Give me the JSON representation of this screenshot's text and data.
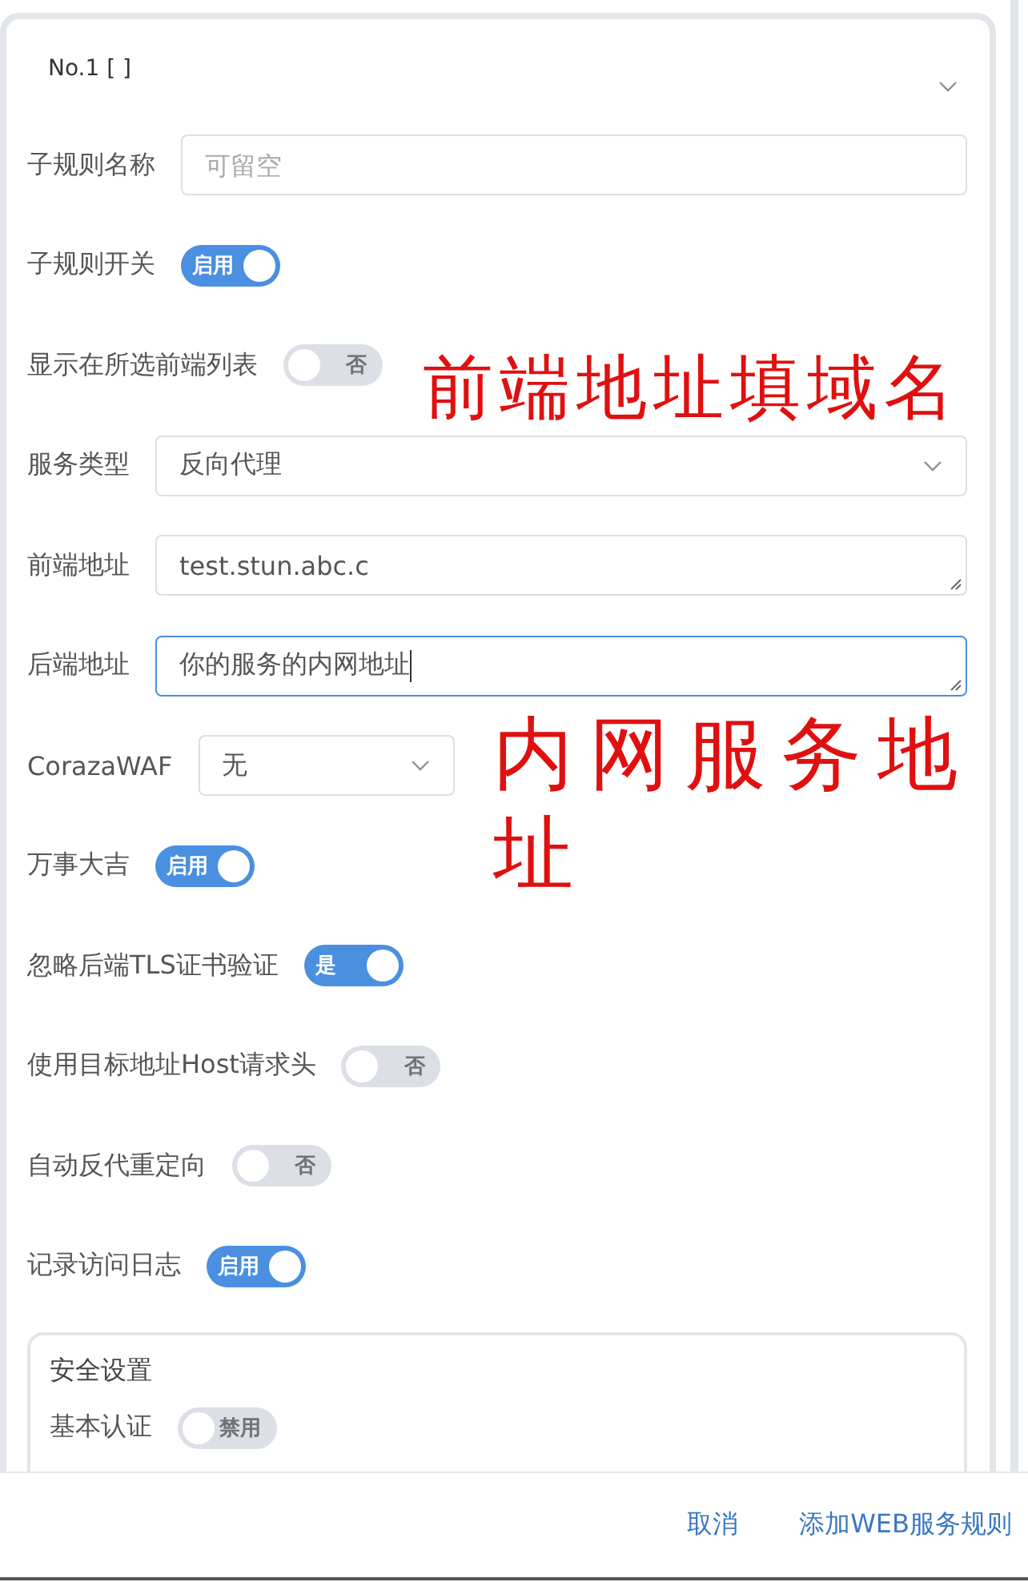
{
  "rule": {
    "title": "No.1 [ ]",
    "expanded": true
  },
  "fields": [
    {
      "kind": "input",
      "label": "子规则名称",
      "placeholder": "可留空"
    },
    {
      "kind": "switch",
      "label": "子规则开关",
      "on": true,
      "text": "启用"
    },
    {
      "kind": "switch",
      "label": "显示在所选前端列表",
      "on": false,
      "text": "否"
    },
    {
      "kind": "select",
      "label": "服务类型",
      "value": "反向代理"
    },
    {
      "kind": "textarea",
      "label": "前端地址",
      "value": "test.stun.abc.c",
      "focused": false
    },
    {
      "kind": "textarea",
      "label": "后端地址",
      "value": "你的服务的内网地址",
      "focused": true
    },
    {
      "kind": "dropdown",
      "label": "CorazaWAF",
      "value": "无"
    },
    {
      "kind": "switch",
      "label": "万事大吉",
      "on": true,
      "text": "启用"
    },
    {
      "kind": "switch",
      "label": "忽略后端TLS证书验证",
      "on": true,
      "text": "是"
    },
    {
      "kind": "switch",
      "label": "使用目标地址Host请求头",
      "on": false,
      "text": "否"
    },
    {
      "kind": "switch",
      "label": "自动反代重定向",
      "on": false,
      "text": "否"
    },
    {
      "kind": "switch",
      "label": "记录访问日志",
      "on": true,
      "text": "启用"
    }
  ],
  "security": {
    "title": "安全设置",
    "fields": [
      {
        "kind": "switch",
        "label": "基本认证",
        "on": false,
        "text": "禁用"
      }
    ]
  },
  "annotations": [
    "前端地址填域名",
    "内网服务地址"
  ],
  "buttons": [
    "取消",
    "添加WEB服务规则"
  ]
}
